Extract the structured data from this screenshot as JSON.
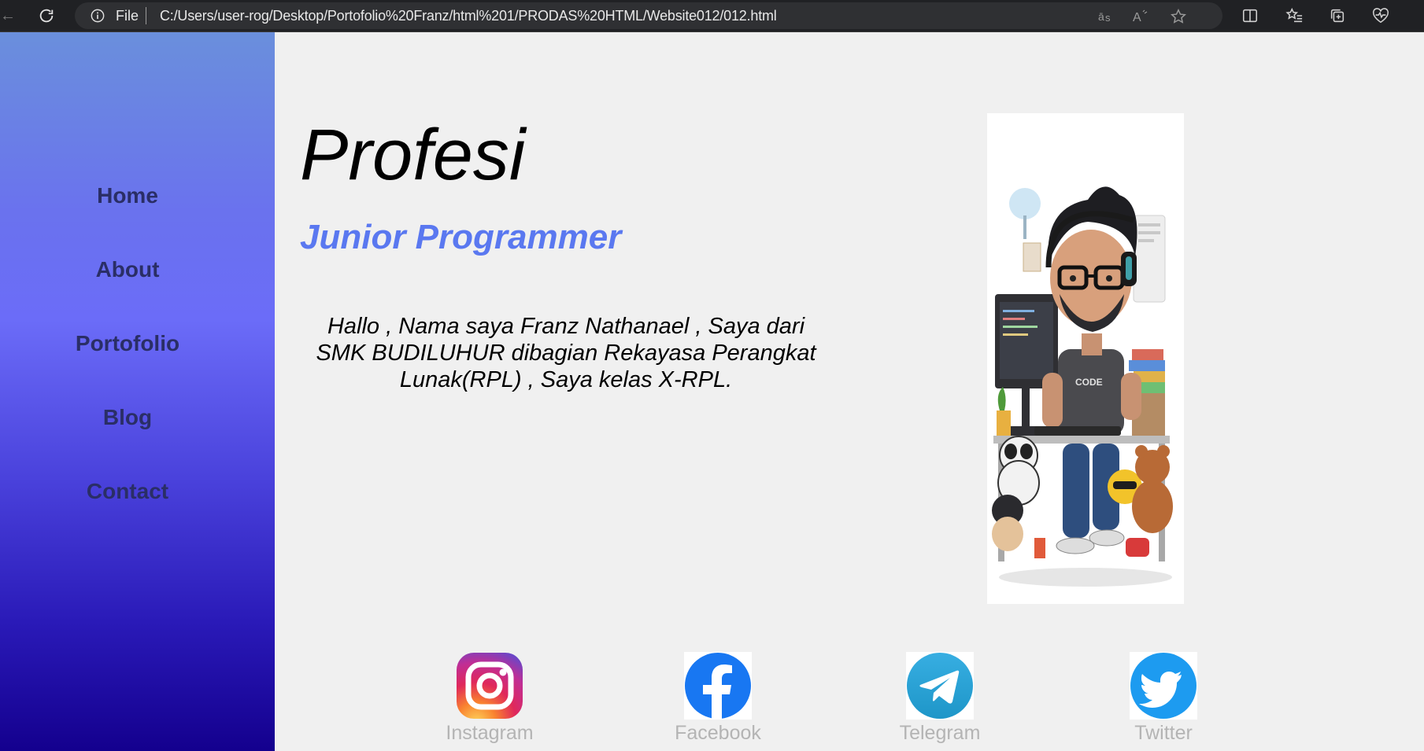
{
  "browser": {
    "scheme_label": "File",
    "url": "C:/Users/user-rog/Desktop/Portofolio%20Franz/html%201/PRODAS%20HTML/Website012/012.html",
    "icons": [
      "back-arrow-icon",
      "reload-icon",
      "info-icon",
      "read-aloud-icon",
      "immersive-reader-icon",
      "favorite-star-icon",
      "split-screen-icon",
      "favorites-list-icon",
      "collections-icon",
      "browser-essentials-icon"
    ]
  },
  "sidebar": {
    "items": [
      {
        "label": "Home"
      },
      {
        "label": "About"
      },
      {
        "label": "Portofolio"
      },
      {
        "label": "Blog"
      },
      {
        "label": "Contact"
      }
    ]
  },
  "main": {
    "title": "Profesi",
    "role": "Junior Programmer",
    "intro_lines": [
      "Hallo , Nama saya Franz Nathanael , Saya dari",
      "SMK BUDILUHUR dibagian Rekayasa Perangkat",
      "Lunak(RPL) , Saya kelas X-RPL."
    ],
    "socials": [
      {
        "label": "Instagram",
        "icon": "instagram-icon"
      },
      {
        "label": "Facebook",
        "icon": "facebook-icon"
      },
      {
        "label": "Telegram",
        "icon": "telegram-icon"
      },
      {
        "label": "Twitter",
        "icon": "twitter-icon"
      }
    ]
  },
  "colors": {
    "role_text": "#5a78f0",
    "nav_text": "#2a2e66",
    "social_label": "#b4b4b4",
    "sidebar_top": "#6a8fdc",
    "sidebar_bottom": "#14008e"
  }
}
